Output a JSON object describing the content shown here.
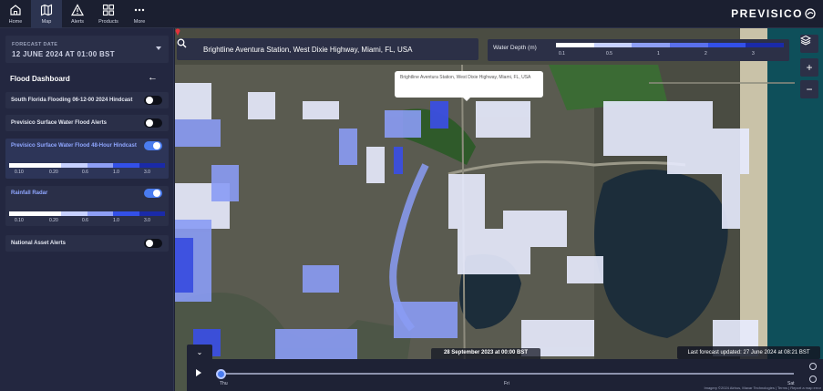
{
  "topnav": {
    "items": [
      {
        "label": "Home",
        "icon": "home-icon"
      },
      {
        "label": "Map",
        "icon": "map-icon"
      },
      {
        "label": "Alerts",
        "icon": "alert-triangle-icon"
      },
      {
        "label": "Products",
        "icon": "grid-icon"
      },
      {
        "label": "More",
        "icon": "more-dots-icon"
      }
    ],
    "active": "Map",
    "logo": "PREVISICO"
  },
  "sidebar": {
    "forecast_label": "FORECAST DATE",
    "forecast_value": "12 JUNE 2024 AT 01:00 BST",
    "dashboard_title": "Flood Dashboard",
    "layers": [
      {
        "name": "South Florida Flooding 06-12-00 2024 Hindcast",
        "enabled": false
      },
      {
        "name": "Previsico Surface Water Flood Alerts",
        "enabled": false
      },
      {
        "name": "Previsico Surface Water Flood 48-Hour Hindcast",
        "enabled": true,
        "legend": [
          "0.10",
          "0.20",
          "0.6",
          "1.0",
          "3.0"
        ]
      },
      {
        "name": "Rainfall Radar",
        "enabled": true,
        "legend": [
          "0.10",
          "0.20",
          "0.6",
          "1.0",
          "3.0"
        ]
      },
      {
        "name": "National Asset Alerts",
        "enabled": false
      }
    ]
  },
  "map": {
    "search_value": "Brightline Aventura Station, West Dixie Highway, Miami, FL, USA",
    "water_depth_title": "Water Depth (m)",
    "water_depth_ticks": [
      "0.1",
      "0.5",
      "1",
      "2",
      "3"
    ],
    "tooltip": "Brightline Aventura Station, West Dixie Highway, Miami, FL, USA",
    "zoom_in": "+",
    "zoom_out": "−",
    "colors": {
      "light": "#e8ecff",
      "mid": "#8a9cf5",
      "strong": "#3b4fe0",
      "deep": "#1a2aa8"
    }
  },
  "timebar": {
    "current_time": "28 September 2023 at 00:00 BST",
    "last_updated": "Last forecast updated: 27 June 2024 at 08:21 BST",
    "days": [
      "Thu",
      "Fri",
      "Sat"
    ],
    "attribution": "Imagery ©2024 Airbus, Maxar Technologies | Terms | Report a map error"
  }
}
